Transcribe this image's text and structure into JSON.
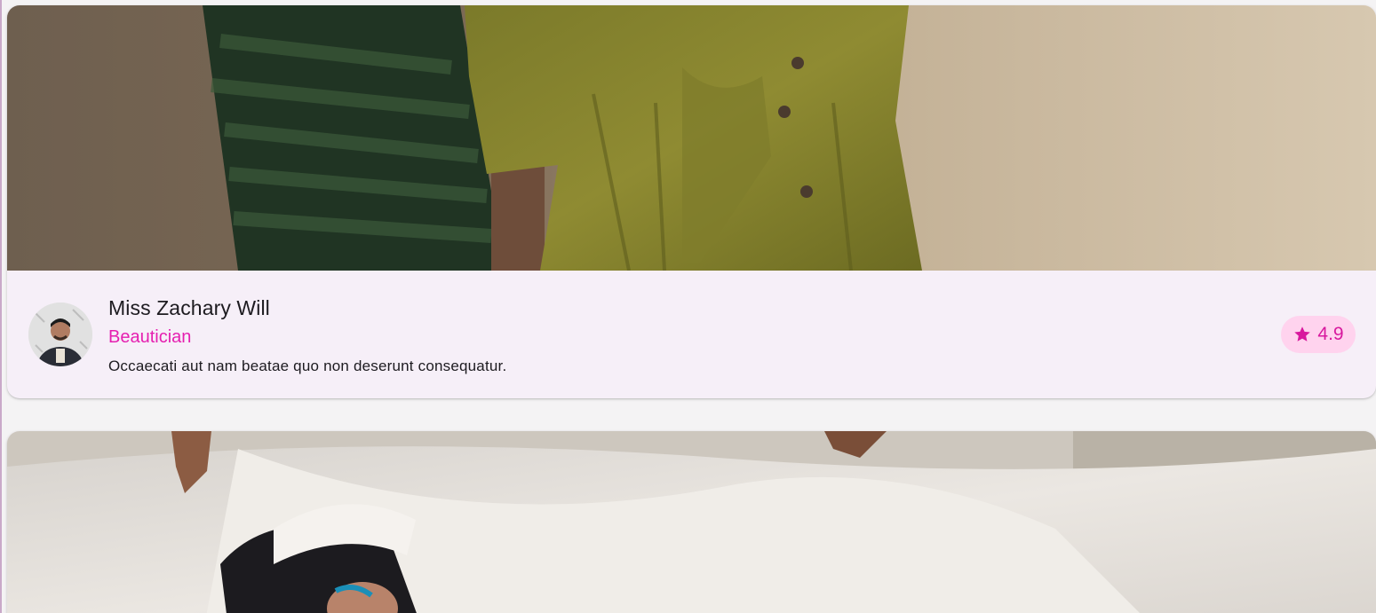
{
  "cards": [
    {
      "name": "Miss Zachary Will",
      "role": "Beautician",
      "description": "Occaecati aut nam beatae quo non deserunt consequatur.",
      "rating": "4.9"
    }
  ],
  "colors": {
    "role": "#e51fb0",
    "rating_bg": "#ffd3ee",
    "rating_fg": "#d8189e",
    "card_bg": "#f6eff8"
  },
  "icons": {
    "rating": "star-icon"
  }
}
